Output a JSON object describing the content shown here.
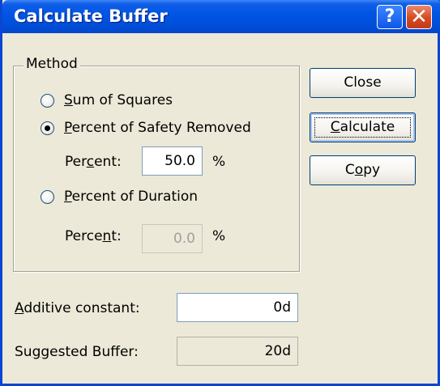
{
  "window": {
    "title": "Calculate Buffer",
    "help_glyph": "?",
    "close_glyph": "✕"
  },
  "method": {
    "legend": "Method",
    "options": [
      {
        "accel": "S",
        "rest": "um of Squares",
        "checked": false
      },
      {
        "accel": "P",
        "rest": "ercent of Safety Removed",
        "checked": true
      },
      {
        "accel": "P",
        "rest": "ercent of Duration",
        "checked": false
      }
    ],
    "safety_percent": {
      "label_a": "Per",
      "label_u": "c",
      "label_b": "ent:",
      "value": "50.0",
      "unit": "%"
    },
    "duration_percent": {
      "label_a": "Perce",
      "label_u": "n",
      "label_b": "t:",
      "value": "0.0",
      "unit": "%"
    }
  },
  "additive_constant": {
    "accel": "A",
    "rest": "dditive constant:",
    "value": "0d"
  },
  "suggested_buffer": {
    "label_a": "Su",
    "label_u": "g",
    "label_b": "gested Buffer:",
    "value": "20d"
  },
  "buttons": {
    "close": "Close",
    "calculate": {
      "accel": "C",
      "rest": "alculate"
    },
    "copy": {
      "a": "C",
      "u": "o",
      "b": "py"
    }
  }
}
